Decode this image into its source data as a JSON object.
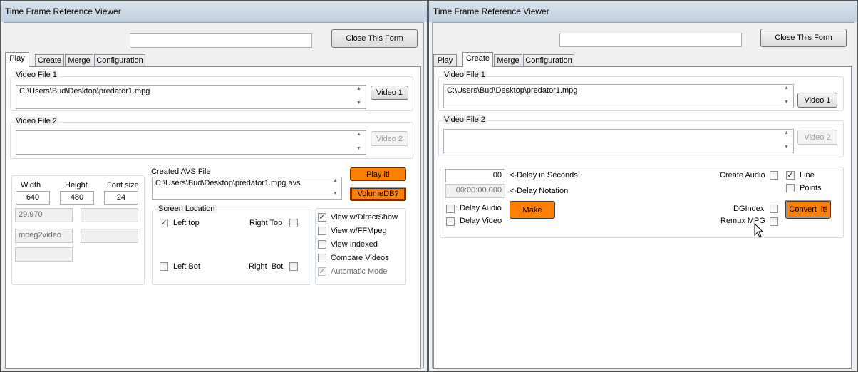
{
  "left": {
    "title": "Time Frame Reference Viewer",
    "top_field_value": "",
    "close_label": "Close This Form",
    "tabs": [
      "Play",
      "Create",
      "Merge",
      "Configuration"
    ],
    "video1": {
      "group": "Video File 1",
      "path": "C:\\Users\\Bud\\Desktop\\predator1.mpg",
      "button": "Video 1"
    },
    "video2": {
      "group": "Video File 2",
      "path": "",
      "button": "Video 2"
    },
    "width_label": "Width",
    "width_value": "640",
    "height_label": "Height",
    "height_value": "480",
    "fontsize_label": "Font size",
    "fontsize_value": "24",
    "fps_value": "29.970",
    "codec_value": "mpeg2video",
    "avs_label": "Created AVS File",
    "avs_path": "C:\\Users\\Bud\\Desktop\\predator1.mpg.avs",
    "play_label": "Play it!",
    "volume_label": "VolumeDB?",
    "screen_location_label": "Screen Location",
    "left_top": "Left top",
    "right_top": "Right Top",
    "left_bot": "Left Bot",
    "right_bot": "Right  Bot",
    "view_directshow": "View w/DirectShow",
    "view_ffmpeg": "View w/FFMpeg",
    "view_indexed": "View Indexed",
    "compare_videos": "Compare Videos",
    "automatic_mode": "Automatic Mode"
  },
  "right": {
    "title": "Time Frame Reference Viewer",
    "top_field_value": "",
    "close_label": "Close This Form",
    "tabs": [
      "Play",
      "Create",
      "Merge",
      "Configuration"
    ],
    "video1": {
      "group": "Video File 1",
      "path": "C:\\Users\\Bud\\Desktop\\predator1.mpg",
      "button": "Video 1"
    },
    "video2": {
      "group": "Video File 2",
      "path": "",
      "button": "Video 2"
    },
    "delay_seconds_value": "00",
    "delay_seconds_label": "<-Delay in Seconds",
    "delay_notation_value": "00:00:00.000",
    "delay_notation_label": "<-Delay Notation",
    "delay_audio": "Delay Audio",
    "delay_video": "Delay Video",
    "make_label": "Make",
    "create_audio": "Create Audio",
    "line": "Line",
    "points": "Points",
    "dgindex": "DGIndex",
    "remux_mpg": "Remux MPG",
    "convert_label": "Convert  it!"
  },
  "colors": {
    "accent_orange": "#ff7f00",
    "titlebar": "#c9d7e5"
  }
}
